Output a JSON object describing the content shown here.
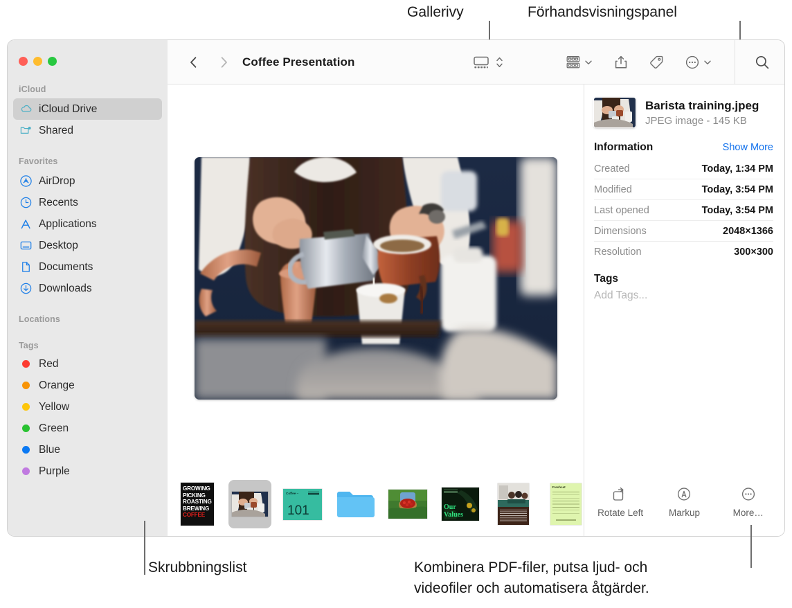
{
  "callouts": [
    {
      "id": "gallery-view",
      "label": "Gallerivy"
    },
    {
      "id": "preview-panel",
      "label": "Förhandsvisningspanel"
    },
    {
      "id": "scrubber-bar",
      "label": "Skrubbningslist"
    },
    {
      "id": "more-actions",
      "label": "Kombinera PDF-filer, putsa ljud- och"
    },
    {
      "id": "more-actions-2",
      "label": "videofiler och automatisera åtgärder."
    }
  ],
  "window": {
    "title": "Coffee Presentation",
    "traffic_lights": [
      {
        "name": "close",
        "color": "#ff5f57"
      },
      {
        "name": "minimize",
        "color": "#febc2e"
      },
      {
        "name": "zoom",
        "color": "#28c840"
      }
    ]
  },
  "toolbar": {
    "back_icon": "chevron-left-icon",
    "forward_icon": "chevron-right-icon",
    "view_gallery_icon": "gallery-view-icon",
    "view_sort_icon": "chevron-updown-icon",
    "group_icon": "group-by-icon",
    "group_chevron_icon": "chevron-down-icon",
    "share_icon": "share-icon",
    "tag_icon": "tag-icon",
    "more_icon": "more-circle-icon",
    "more_chevron_icon": "chevron-down-icon",
    "search_icon": "search-icon"
  },
  "sidebar": {
    "sections": [
      {
        "header": "iCloud",
        "items": [
          {
            "label": "iCloud Drive",
            "icon": "cloud-icon",
            "selected": true,
            "color": "#5ab4c9"
          },
          {
            "label": "Shared",
            "icon": "shared-folder-icon",
            "selected": false,
            "color": "#5ab4c9"
          }
        ]
      },
      {
        "header": "Favorites",
        "items": [
          {
            "label": "AirDrop",
            "icon": "airdrop-icon",
            "selected": false,
            "color": "#1d7fe8"
          },
          {
            "label": "Recents",
            "icon": "clock-icon",
            "selected": false,
            "color": "#1d7fe8"
          },
          {
            "label": "Applications",
            "icon": "applications-icon",
            "selected": false,
            "color": "#1d7fe8"
          },
          {
            "label": "Desktop",
            "icon": "desktop-icon",
            "selected": false,
            "color": "#1d7fe8"
          },
          {
            "label": "Documents",
            "icon": "document-icon",
            "selected": false,
            "color": "#1d7fe8"
          },
          {
            "label": "Downloads",
            "icon": "download-icon",
            "selected": false,
            "color": "#1d7fe8"
          }
        ]
      },
      {
        "header": "Locations",
        "items": []
      }
    ],
    "tags_header": "Tags",
    "tags": [
      {
        "label": "Red",
        "color": "#fc3b30"
      },
      {
        "label": "Orange",
        "color": "#f89406"
      },
      {
        "label": "Yellow",
        "color": "#fdc60b"
      },
      {
        "label": "Green",
        "color": "#29c231"
      },
      {
        "label": "Blue",
        "color": "#0b79f3"
      },
      {
        "label": "Purple",
        "color": "#c07ae0"
      }
    ]
  },
  "gallery": {
    "preview_alt": "Barista pouring milk into a coffee cup",
    "thumbnails": [
      {
        "name": "coffee-poster",
        "type": "poster",
        "lines": [
          "GROWING",
          "PICKING",
          "ROASTING",
          "BREWING"
        ],
        "accent_line": "COFFEE",
        "selected": false
      },
      {
        "name": "barista-photo",
        "type": "photo",
        "selected": true
      },
      {
        "name": "coffee-101",
        "type": "slide",
        "title": "Coffee –",
        "big": "101",
        "selected": false
      },
      {
        "name": "folder",
        "type": "folder",
        "selected": false
      },
      {
        "name": "berries-photo",
        "type": "photo2",
        "selected": false
      },
      {
        "name": "our-values",
        "type": "values",
        "line1": "Our",
        "line2": "Values",
        "selected": false
      },
      {
        "name": "meeting-doc",
        "type": "doc",
        "selected": false
      },
      {
        "name": "budget-sheet",
        "type": "sheet",
        "selected": false
      }
    ]
  },
  "info": {
    "file_name": "Barista training.jpeg",
    "file_subtitle": "JPEG image - 145 KB",
    "section_title": "Information",
    "show_more": "Show More",
    "rows": [
      {
        "key": "Created",
        "value": "Today, 1:34 PM"
      },
      {
        "key": "Modified",
        "value": "Today, 3:54 PM"
      },
      {
        "key": "Last opened",
        "value": "Today, 3:54 PM"
      },
      {
        "key": "Dimensions",
        "value": "2048×1366"
      },
      {
        "key": "Resolution",
        "value": "300×300"
      }
    ],
    "tags_title": "Tags",
    "tags_placeholder": "Add Tags...",
    "actions": [
      {
        "label": "Rotate Left",
        "icon": "rotate-left-icon"
      },
      {
        "label": "Markup",
        "icon": "markup-icon"
      },
      {
        "label": "More…",
        "icon": "more-circle-icon"
      }
    ]
  },
  "colors": {
    "accent_blue": "#1372ec",
    "sidebar_bg": "#e9e9e9",
    "selected_row": "#d0d0d0"
  }
}
